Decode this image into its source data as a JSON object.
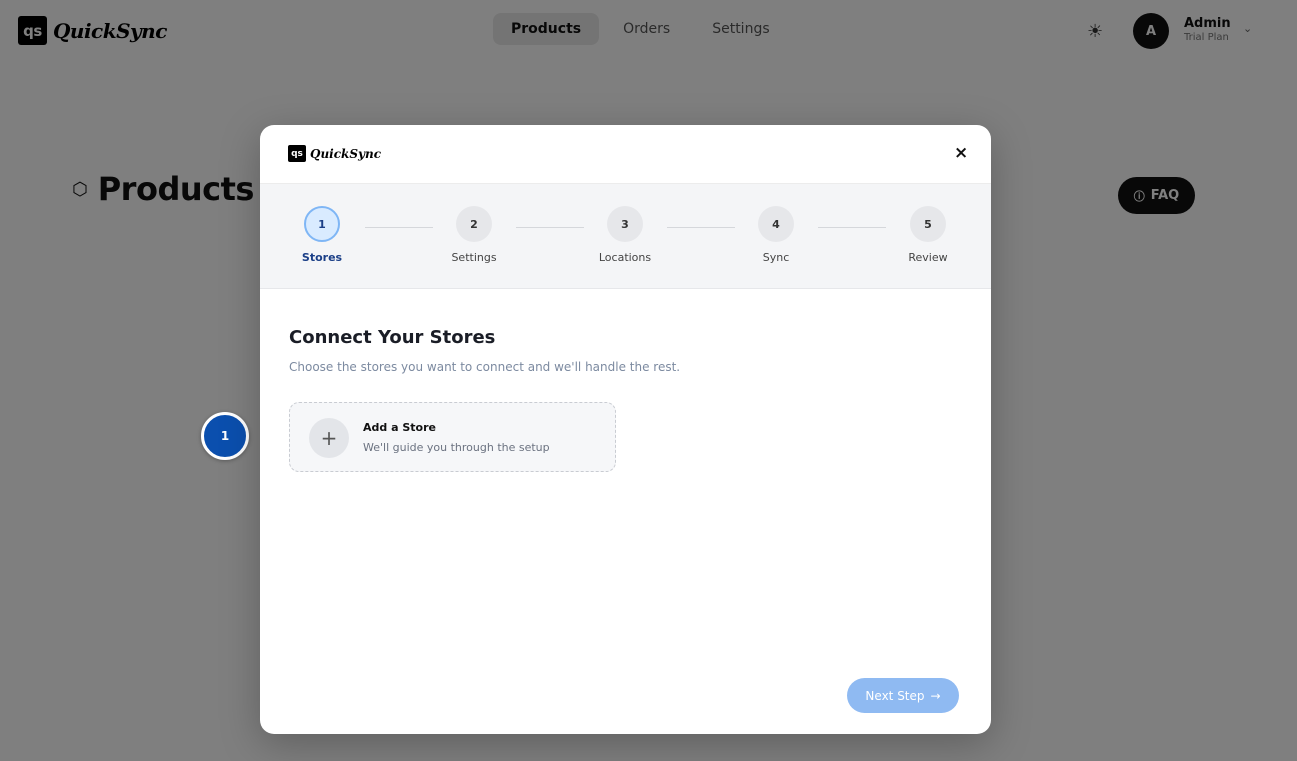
{
  "app": {
    "logo_badge": "qs",
    "logo_text": "QuickSync"
  },
  "nav": {
    "tabs": [
      {
        "label": "Products"
      },
      {
        "label": "Orders"
      },
      {
        "label": "Settings"
      }
    ]
  },
  "theme_icon": "sun-icon",
  "user": {
    "initial": "A",
    "name": "Admin",
    "plan": "Trial Plan"
  },
  "page": {
    "title": "Products",
    "faq_label": "FAQ"
  },
  "tour": {
    "badge_number": "1"
  },
  "modal": {
    "logo_badge": "qs",
    "logo_text": "QuickSync",
    "close_glyph": "×",
    "steps": [
      {
        "number": "1",
        "label": "Stores",
        "active": true
      },
      {
        "number": "2",
        "label": "Settings",
        "active": false
      },
      {
        "number": "3",
        "label": "Locations",
        "active": false
      },
      {
        "number": "4",
        "label": "Sync",
        "active": false
      },
      {
        "number": "5",
        "label": "Review",
        "active": false
      }
    ],
    "title": "Connect Your Stores",
    "subtitle": "Choose the stores you want to connect and we'll handle the rest.",
    "add_store": {
      "title": "Add a Store",
      "subtitle": "We'll guide you through the setup"
    },
    "next_label": "Next Step"
  },
  "colors": {
    "tour_badge": "#0b4fae",
    "active_step": "#1b3f87",
    "next_button": "#8fbaf2",
    "overlay": "rgba(0,0,0,0.5)"
  }
}
